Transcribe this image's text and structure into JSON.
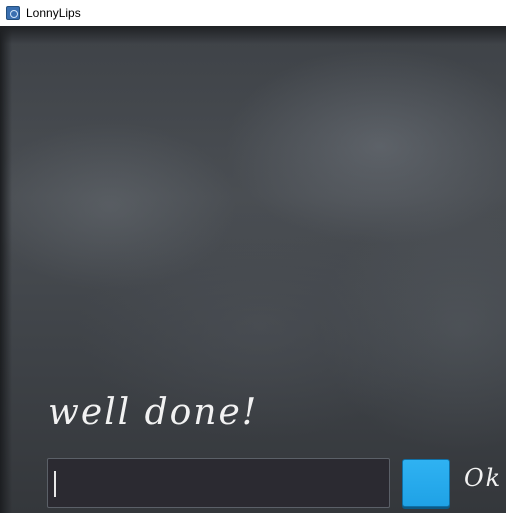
{
  "window": {
    "title": "LonnyLips",
    "icon": "app-icon"
  },
  "board": {
    "message": "well done!",
    "answer_value": "",
    "ok_label": "Ok",
    "ok_button_color": "#29aef0"
  }
}
